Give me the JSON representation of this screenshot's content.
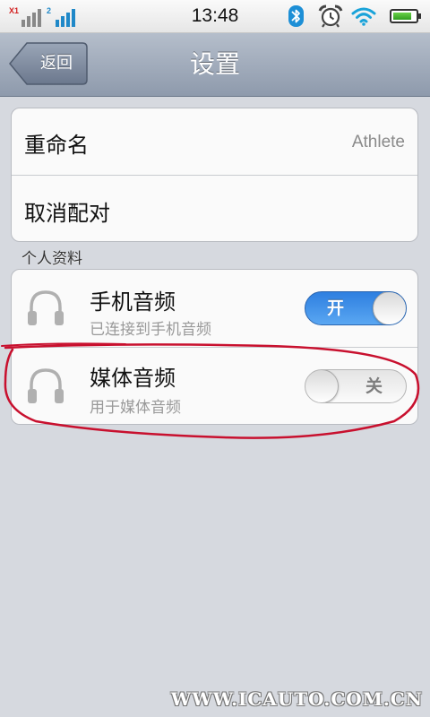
{
  "status_bar": {
    "sim1_tag": "X1",
    "sim2_tag": "2",
    "time": "13:48",
    "battery_level": 0.85,
    "icons": [
      "signal-icon",
      "signal-icon",
      "bluetooth-icon",
      "alarm-icon",
      "wifi-icon",
      "battery-icon"
    ]
  },
  "nav": {
    "back_label": "返回",
    "title": "设置"
  },
  "device_group": {
    "rename_label": "重命名",
    "rename_value": "Athlete",
    "unpair_label": "取消配对"
  },
  "profiles": {
    "header": "个人资料",
    "items": [
      {
        "name": "手机音频",
        "status": "已连接到手机音频",
        "toggle_label": "开",
        "enabled": true,
        "icon": "headset-icon"
      },
      {
        "name": "媒体音频",
        "status": "用于媒体音频",
        "toggle_label": "关",
        "enabled": false,
        "icon": "headset-icon"
      }
    ]
  },
  "watermark": "WWW.ICAUTO.COM.CN",
  "colors": {
    "toggle_on": "#2e7fe0",
    "annotation": "#c8102e",
    "bluetooth": "#1d8fd6",
    "signal_active": "#1f88c8"
  }
}
